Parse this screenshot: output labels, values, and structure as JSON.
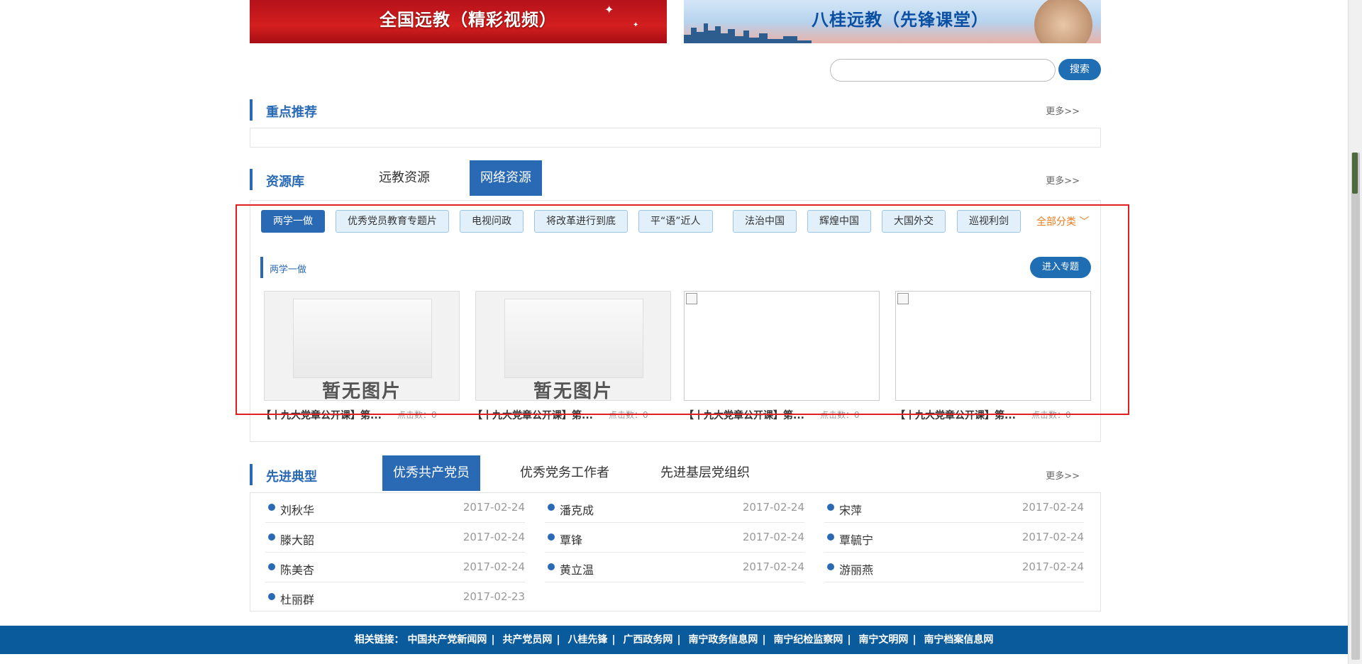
{
  "banners": {
    "left": "全国远教（精彩视频）",
    "right": "八桂远教（先锋课堂）"
  },
  "search": {
    "placeholder": "",
    "button": "搜索"
  },
  "featured": {
    "title": "重点推荐",
    "more": "更多>>"
  },
  "resources": {
    "title": "资源库",
    "tabs": [
      "远教资源",
      "网络资源"
    ],
    "active_tab": "网络资源",
    "more": "更多>>",
    "categories": [
      "两学一做",
      "优秀党员教育专题片",
      "电视问政",
      "将改革进行到底",
      "平“语”近人",
      "法治中国",
      "辉煌中国",
      "大国外交",
      "巡视利剑"
    ],
    "active_category": "两学一做",
    "all_categories": "全部分类",
    "subtitle": "两学一做",
    "enter_button": "进入专题",
    "noimg_text": "暂无图片",
    "items": [
      {
        "title": "【十九大党章公开课】第...",
        "clicks": "点击数：0"
      },
      {
        "title": "【十九大党章公开课】第...",
        "clicks": "点击数：0"
      },
      {
        "title": "【十九大党章公开课】第...",
        "clicks": "点击数：0"
      },
      {
        "title": "【十九大党章公开课】第...",
        "clicks": "点击数：0"
      }
    ]
  },
  "advanced": {
    "title": "先进典型",
    "tabs": [
      "优秀共产党员",
      "优秀党务工作者",
      "先进基层党组织"
    ],
    "active_tab": "优秀共产党员",
    "more": "更多>>",
    "columns": [
      [
        {
          "name": "刘秋华",
          "date": "2017-02-24"
        },
        {
          "name": "滕大韶",
          "date": "2017-02-24"
        },
        {
          "name": "陈美杏",
          "date": "2017-02-24"
        },
        {
          "name": "杜丽群",
          "date": "2017-02-23"
        }
      ],
      [
        {
          "name": "潘克成",
          "date": "2017-02-24"
        },
        {
          "name": "覃锋",
          "date": "2017-02-24"
        },
        {
          "name": "黄立温",
          "date": "2017-02-24"
        }
      ],
      [
        {
          "name": "宋萍",
          "date": "2017-02-24"
        },
        {
          "name": "覃毓宁",
          "date": "2017-02-24"
        },
        {
          "name": "游丽燕",
          "date": "2017-02-24"
        }
      ]
    ]
  },
  "footer": {
    "label": "相关链接：",
    "links": [
      "中国共产党新闻网",
      "共产党员网",
      "八桂先锋",
      "广西政务网",
      "南宁政务信息网",
      "南宁纪检监察网",
      "南宁文明网",
      "南宁档案信息网"
    ]
  }
}
